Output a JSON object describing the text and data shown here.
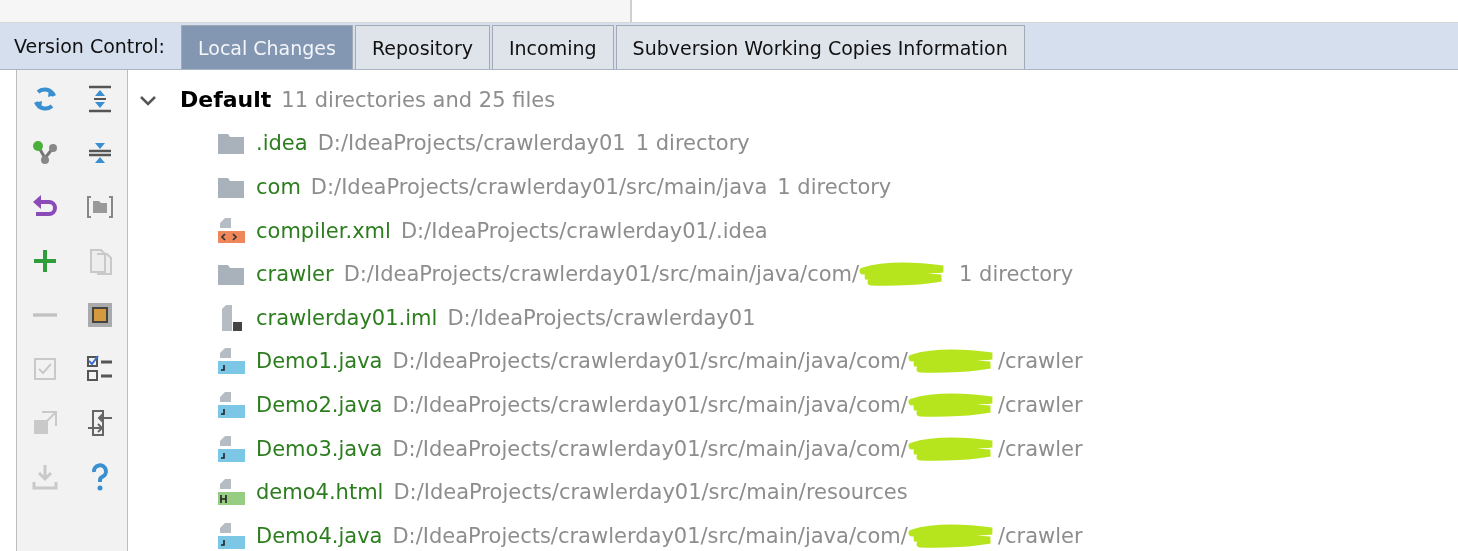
{
  "tabs_label": "Version Control:",
  "tabs": [
    {
      "label": "Local Changes",
      "selected": true
    },
    {
      "label": "Repository",
      "selected": false
    },
    {
      "label": "Incoming",
      "selected": false
    },
    {
      "label": "Subversion Working Copies Information",
      "selected": false
    }
  ],
  "toolbar": [
    {
      "kind": "refresh",
      "disabled": false
    },
    {
      "kind": "expand",
      "disabled": false
    },
    {
      "kind": "branch",
      "disabled": false
    },
    {
      "kind": "collapse",
      "disabled": false
    },
    {
      "kind": "rollback",
      "disabled": false
    },
    {
      "kind": "group",
      "disabled": false
    },
    {
      "kind": "add",
      "disabled": false
    },
    {
      "kind": "copy",
      "disabled": true
    },
    {
      "kind": "remove",
      "disabled": true
    },
    {
      "kind": "preview",
      "disabled": false
    },
    {
      "kind": "check",
      "disabled": true
    },
    {
      "kind": "checklist",
      "disabled": false
    },
    {
      "kind": "share",
      "disabled": true
    },
    {
      "kind": "move",
      "disabled": false
    },
    {
      "kind": "download",
      "disabled": true
    },
    {
      "kind": "help",
      "disabled": false
    }
  ],
  "changelist": {
    "name": "Default",
    "summary": "11 directories and 25 files",
    "expanded": true,
    "children": [
      {
        "kind": "folder",
        "name": ".idea",
        "path": "D:/IdeaProjects/crawlerday01",
        "note": "1 directory"
      },
      {
        "kind": "folder",
        "name": "com",
        "path": "D:/IdeaProjects/crawlerday01/src/main/java",
        "note": "1 directory"
      },
      {
        "kind": "xml",
        "name": "compiler.xml",
        "path": "D:/IdeaProjects/crawlerday01/.idea"
      },
      {
        "kind": "folder",
        "name": "crawler",
        "path": "D:/IdeaProjects/crawlerday01/src/main/java/com/",
        "redacted": true,
        "note": "1 directory"
      },
      {
        "kind": "iml",
        "name": "crawlerday01.iml",
        "path": "D:/IdeaProjects/crawlerday01"
      },
      {
        "kind": "java",
        "name": "Demo1.java",
        "path": "D:/IdeaProjects/crawlerday01/src/main/java/com/",
        "redacted": true,
        "path_end": "/crawler"
      },
      {
        "kind": "java",
        "name": "Demo2.java",
        "path": "D:/IdeaProjects/crawlerday01/src/main/java/com/",
        "redacted": true,
        "path_end": "/crawler"
      },
      {
        "kind": "java",
        "name": "Demo3.java",
        "path": "D:/IdeaProjects/crawlerday01/src/main/java/com/",
        "redacted": true,
        "path_end": "/crawler"
      },
      {
        "kind": "html",
        "name": "demo4.html",
        "path": "D:/IdeaProjects/crawlerday01/src/main/resources"
      },
      {
        "kind": "java",
        "name": "Demo4.java",
        "path": "D:/IdeaProjects/crawlerday01/src/main/java/com/",
        "redacted": true,
        "path_end": "/crawler"
      }
    ]
  }
}
